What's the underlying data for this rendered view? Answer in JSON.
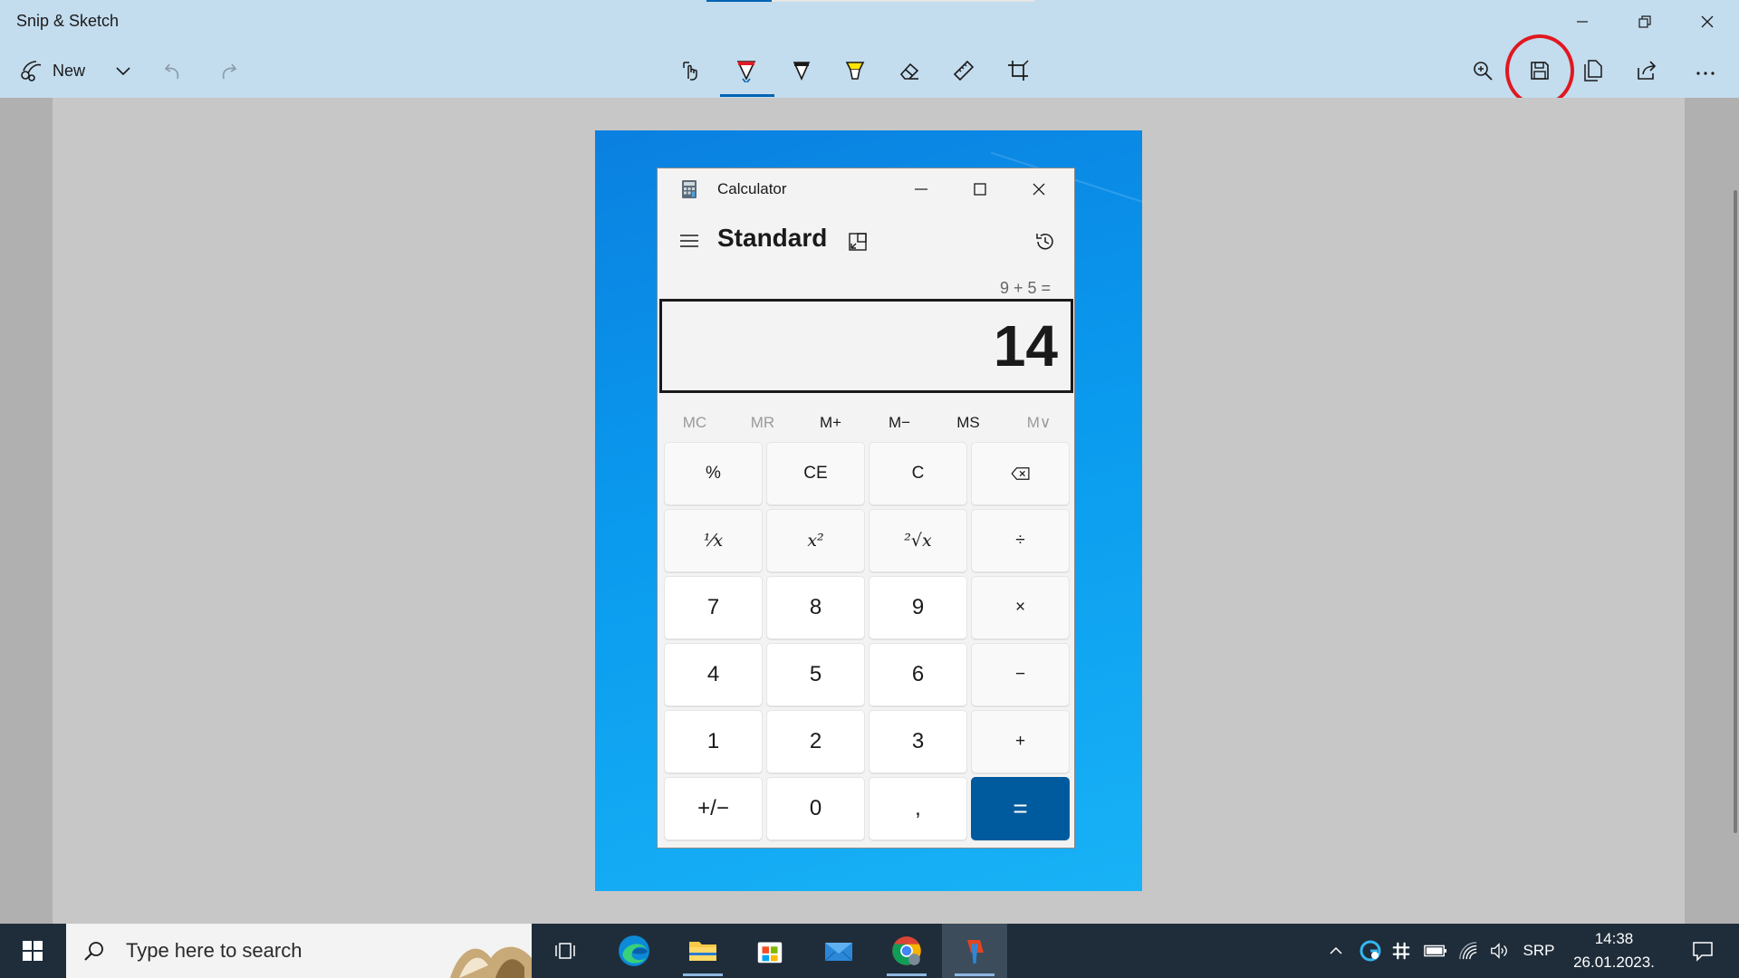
{
  "app": {
    "title": "Snip & Sketch",
    "new_label": "New"
  },
  "toolbar": {
    "tools": [
      "touch-writing",
      "ballpoint-pen",
      "pencil",
      "highlighter",
      "eraser",
      "ruler",
      "image-crop"
    ],
    "right_actions": [
      "zoom",
      "save",
      "copy",
      "share",
      "see-more"
    ],
    "highlight_color": "#e0181f"
  },
  "calculator": {
    "title": "Calculator",
    "mode": "Standard",
    "expression": "9 + 5 =",
    "result": "14",
    "memory": [
      {
        "label": "MC",
        "enabled": false
      },
      {
        "label": "MR",
        "enabled": false
      },
      {
        "label": "M+",
        "enabled": true
      },
      {
        "label": "M−",
        "enabled": true
      },
      {
        "label": "MS",
        "enabled": true
      },
      {
        "label": "M∨",
        "enabled": false
      }
    ],
    "keys": [
      [
        "%",
        "CE",
        "C",
        "backspace"
      ],
      [
        "¹⁄x",
        "x²",
        "²√x",
        "÷"
      ],
      [
        "7",
        "8",
        "9",
        "×"
      ],
      [
        "4",
        "5",
        "6",
        "−"
      ],
      [
        "1",
        "2",
        "3",
        "+"
      ],
      [
        "+/−",
        "0",
        ",",
        "="
      ]
    ],
    "accent_color": "#005a9e"
  },
  "taskbar": {
    "search_placeholder": "Type here to search",
    "apps": [
      "task-view",
      "edge",
      "file-explorer",
      "microsoft-store",
      "mail",
      "chrome",
      "snip-sketch"
    ],
    "language": "SRP",
    "time": "14:38",
    "date": "26.01.2023."
  }
}
